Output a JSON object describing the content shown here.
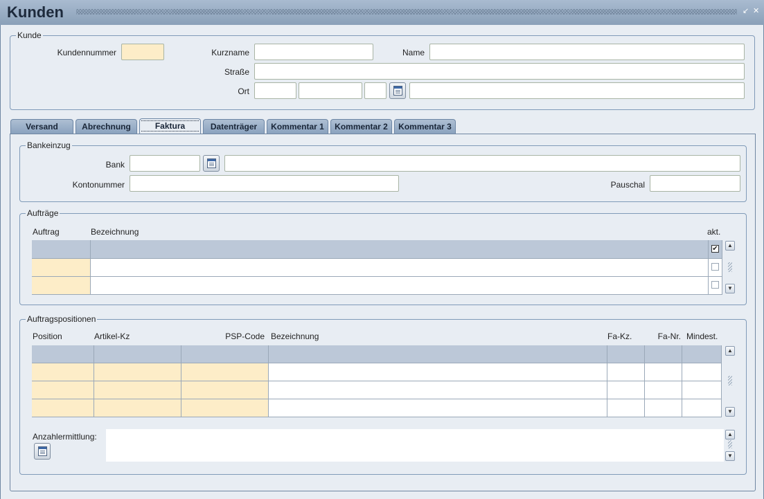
{
  "window": {
    "title": "Kunden"
  },
  "kunde": {
    "legend": "Kunde",
    "kundennummer_label": "Kundennummer",
    "kurzname_label": "Kurzname",
    "name_label": "Name",
    "strasse_label": "Straße",
    "ort_label": "Ort"
  },
  "tabs": [
    "Versand",
    "Abrechnung",
    "Faktura",
    "Datenträger",
    "Kommentar 1",
    "Kommentar 2",
    "Kommentar 3"
  ],
  "active_tab": "Faktura",
  "bankeinzug": {
    "legend": "Bankeinzug",
    "bank_label": "Bank",
    "kontonummer_label": "Kontonummer",
    "pauschal_label": "Pauschal"
  },
  "auftraege": {
    "legend": "Aufträge",
    "columns": [
      "Auftrag",
      "Bezeichnung",
      "akt."
    ],
    "akt_checked": [
      true,
      false,
      false
    ]
  },
  "auftragspositionen": {
    "legend": "Auftragspositionen",
    "columns": [
      "Position",
      "Artikel-Kz",
      "PSP-Code",
      "Bezeichnung",
      "Fa-Kz.",
      "Fa-Nr.",
      "Mindest."
    ],
    "anzahlermittlung_label": "Anzahlermittlung:"
  }
}
